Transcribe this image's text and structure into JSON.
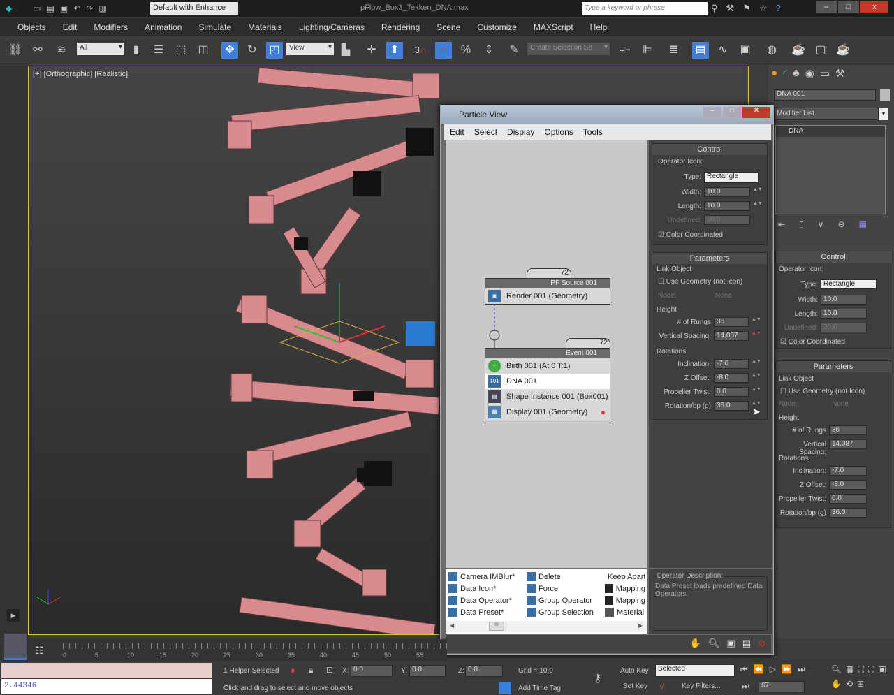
{
  "titlebar": {
    "workspace": "Default with Enhance",
    "file_title": "pFlow_Box3_Tekken_DNA.max",
    "search_placeholder": "Type a keyword or phrase",
    "minimize": "–",
    "maximize": "□",
    "close": "x"
  },
  "menubar": [
    "Objects",
    "Edit",
    "Modifiers",
    "Animation",
    "Simulate",
    "Materials",
    "Lighting/Cameras",
    "Rendering",
    "Scene",
    "Customize",
    "MAXScript",
    "Help"
  ],
  "toolbar": {
    "selection_filter": "All",
    "ref_coord": "View",
    "snap_label": "3",
    "named_selection": "Create Selection Se"
  },
  "viewport": {
    "label": "[+] [Orthographic] [Realistic]"
  },
  "command_panel": {
    "object_name": "DNA 001",
    "modifier_list": "Modifier List",
    "stack_item": "DNA",
    "control": {
      "title": "Control",
      "group": "Operator Icon:",
      "type_label": "Type:",
      "type_value": "Rectangle",
      "width_label": "Width:",
      "width_value": "10.0",
      "length_label": "Length:",
      "length_value": "10.0",
      "undefined_label": "Undefined:",
      "undefined_value": "20.0",
      "color_coord": "Color Coordinated"
    },
    "parameters": {
      "title": "Parameters",
      "link_group": "Link Object",
      "use_geometry": "Use Geometry (not Icon)",
      "node_label": "Node:",
      "node_value": "None",
      "height_group": "Height",
      "rungs_label": "# of Rungs",
      "rungs_value": "36",
      "spacing_label": "Vertical Spacing:",
      "spacing_value": "14.087",
      "rot_group": "Rotations",
      "incl_label": "Inclination:",
      "incl_value": "-7.0",
      "zoff_label": "Z Offset:",
      "zoff_value": "-8.0",
      "twist_label": "Propeller Twist:",
      "twist_value": "0.0",
      "rotbp_label": "Rotation/bp (g)",
      "rotbp_value": "36.0"
    }
  },
  "particle_view": {
    "title": "Particle View",
    "menu": [
      "Edit",
      "Select",
      "Display",
      "Options",
      "Tools"
    ],
    "source_node": {
      "count": "72",
      "title": "PF Source 001",
      "rows": [
        "Render 001 (Geometry)"
      ]
    },
    "event_node": {
      "count": "72",
      "title": "Event 001",
      "rows": [
        "Birth 001 (At 0 T:1)",
        "DNA 001",
        "Shape Instance 001 (Box001)",
        "Display 001 (Geometry)"
      ]
    },
    "depot": {
      "col1": [
        "Camera IMBlur*",
        "Data Icon*",
        "Data Operator*",
        "Data Preset*"
      ],
      "col2": [
        "Delete",
        "Force",
        "Group Operator",
        "Group Selection"
      ],
      "col3": [
        "Keep Apart",
        "Mapping",
        "Mapping",
        "Material"
      ],
      "scroll_grip": "III"
    },
    "description": {
      "title": "Operator Description:",
      "text": "Data Preset loads predefined Data Operators."
    }
  },
  "timeline": {
    "ticks": [
      "0",
      "5",
      "10",
      "15",
      "20",
      "25",
      "30",
      "35",
      "40",
      "45",
      "50",
      "55"
    ]
  },
  "status": {
    "script_value": "2.44346",
    "selected": "1 Helper Selected",
    "x_label": "X:",
    "x": "0.0",
    "y_label": "Y:",
    "y": "0.0",
    "z_label": "Z:",
    "z": "0.0",
    "grid": "Grid = 10.0",
    "prompt": "Click and drag to select and move objects",
    "add_time_tag": "Add Time Tag",
    "auto_key": "Auto Key",
    "set_key": "Set Key",
    "key_mode": "Selected",
    "key_filters": "Key Filters...",
    "frame": "67"
  }
}
